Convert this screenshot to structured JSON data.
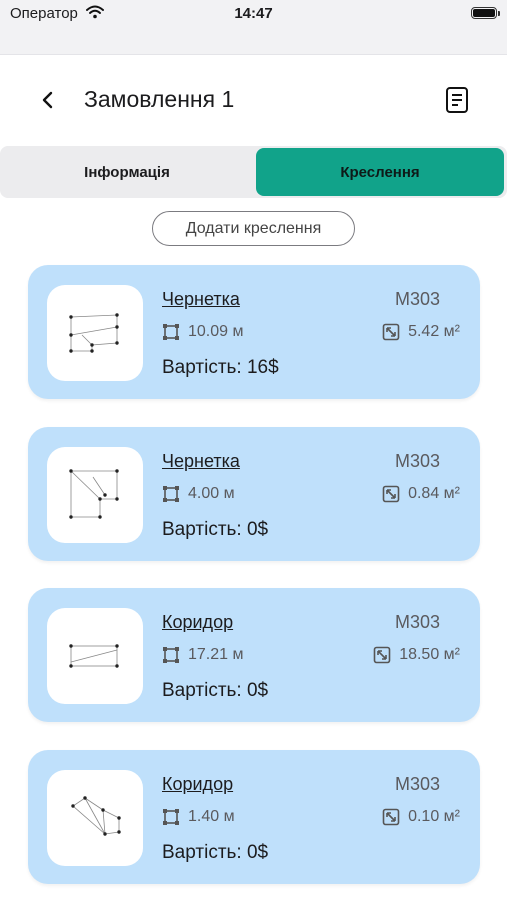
{
  "status": {
    "carrier": "Оператор",
    "time": "14:47"
  },
  "header": {
    "title": "Замовлення 1"
  },
  "tabs": [
    {
      "label": "Інформація"
    },
    {
      "label": "Креслення"
    }
  ],
  "add_button": "Додати креслення",
  "cards": [
    {
      "name": "Чернетка",
      "code": "M303",
      "perimeter": "10.09 м",
      "area": "5.42 м²",
      "cost": "Вартість: 16$"
    },
    {
      "name": "Чернетка",
      "code": "M303",
      "perimeter": "4.00 м",
      "area": "0.84 м²",
      "cost": "Вартість: 0$"
    },
    {
      "name": "Коридор",
      "code": "M303",
      "perimeter": "17.21 м",
      "area": "18.50 м²",
      "cost": "Вартість: 0$"
    },
    {
      "name": "Коридор",
      "code": "M303",
      "perimeter": "1.40 м",
      "area": "0.10 м²",
      "cost": "Вартість: 0$"
    }
  ],
  "colors": {
    "accent": "#11a38a",
    "card_bg": "#bfe0fb"
  }
}
